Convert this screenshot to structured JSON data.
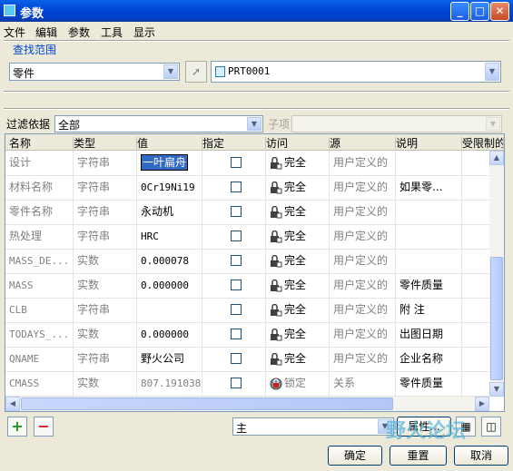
{
  "window": {
    "title": "参数"
  },
  "menu": [
    "文件",
    "编辑",
    "参数",
    "工具",
    "显示"
  ],
  "search": {
    "group_label": "查找范围",
    "scope_value": "零件",
    "model_value": "PRT0001"
  },
  "filter": {
    "label": "过滤依据",
    "value": "全部",
    "subitem_label": "子项"
  },
  "table": {
    "columns": [
      "名称",
      "类型",
      "值",
      "指定",
      "访问",
      "源",
      "说明",
      "受限制的"
    ],
    "rows": [
      {
        "name": "设计",
        "type": "字符串",
        "value": "一叶扁舟",
        "access": "完全",
        "source": "用户定义的",
        "desc": "",
        "editing": true
      },
      {
        "name": "材料名称",
        "type": "字符串",
        "value": "0Cr19Ni19",
        "access": "完全",
        "source": "用户定义的",
        "desc": "如果零..."
      },
      {
        "name": "零件名称",
        "type": "字符串",
        "value": "永动机",
        "access": "完全",
        "source": "用户定义的",
        "desc": ""
      },
      {
        "name": "热处理",
        "type": "字符串",
        "value": "HRC",
        "access": "完全",
        "source": "用户定义的",
        "desc": ""
      },
      {
        "name": "MASS_DE...",
        "type": "实数",
        "value": "0.000078",
        "access": "完全",
        "source": "用户定义的",
        "desc": ""
      },
      {
        "name": "MASS",
        "type": "实数",
        "value": "0.000000",
        "access": "完全",
        "source": "用户定义的",
        "desc": "零件质量"
      },
      {
        "name": "CLB",
        "type": "字符串",
        "value": "",
        "access": "完全",
        "source": "用户定义的",
        "desc": "附 注"
      },
      {
        "name": "TODAYS_...",
        "type": "实数",
        "value": "0.000000",
        "access": "完全",
        "source": "用户定义的",
        "desc": "出图日期"
      },
      {
        "name": "QNAME",
        "type": "字符串",
        "value": "野火公司",
        "access": "完全",
        "source": "用户定义的",
        "desc": "企业名称"
      },
      {
        "name": "CMASS",
        "type": "实数",
        "value": "807.191038",
        "access": "锁定",
        "source": "关系",
        "desc": "零件质量",
        "locked": true
      }
    ]
  },
  "bottom": {
    "main_value": "主",
    "properties_label": "属性...",
    "ok_label": "确定",
    "reset_label": "重置",
    "cancel_label": "取消",
    "add_label": "+",
    "remove_label": "−"
  },
  "watermark": {
    "text": "野火论坛"
  }
}
